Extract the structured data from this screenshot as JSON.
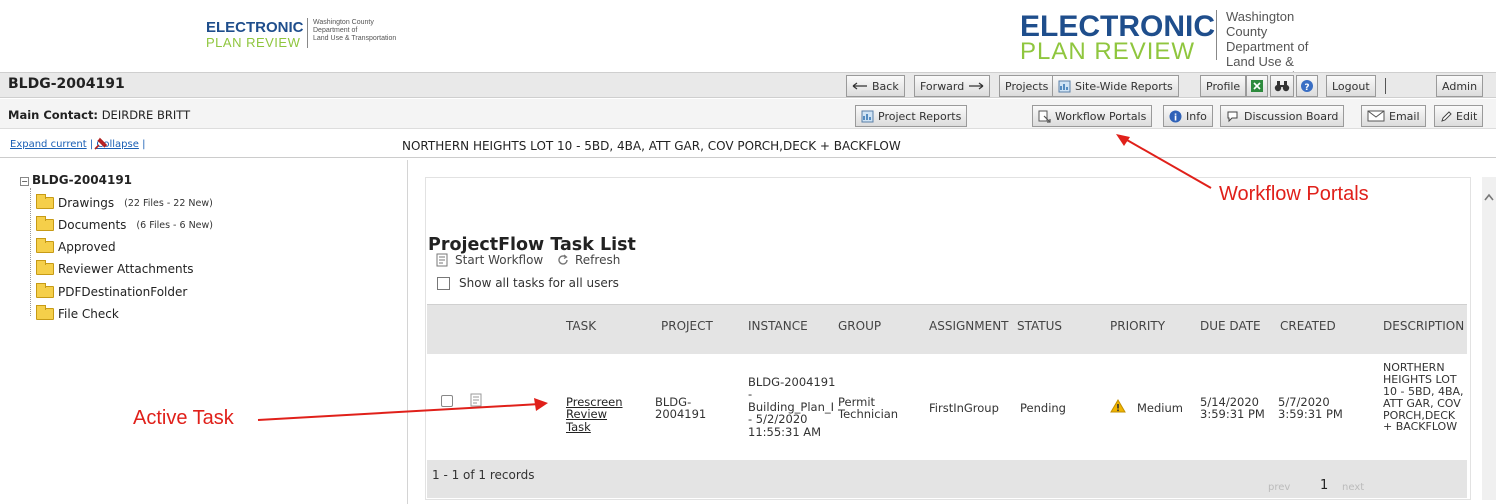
{
  "left_logo": {
    "title": "ELECTRONIC",
    "subtitle": "PLAN REVIEW",
    "dept_lines": [
      "Washington County",
      "Department of",
      "Land Use & Transportation"
    ]
  },
  "right_logo": {
    "title": "ELECTRONIC",
    "subtitle": "PLAN REVIEW",
    "dept_lines": [
      "Washington County",
      "Department of",
      "Land Use & Transportation"
    ]
  },
  "project_id": "BLDG-2004191",
  "nav_buttons": {
    "back": "Back",
    "forward": "Forward",
    "projects": "Projects",
    "site_wide_reports": "Site-Wide Reports",
    "profile": "Profile",
    "logout": "Logout",
    "admin": "Admin"
  },
  "contact": {
    "label": "Main Contact:",
    "name": "DEIRDRE BRITT"
  },
  "action_buttons": {
    "project_reports": "Project Reports",
    "workflow_portals": "Workflow Portals",
    "info": "Info",
    "discussion_board": "Discussion Board",
    "email": "Email",
    "edit": "Edit"
  },
  "tree_controls": {
    "expand": "Expand current",
    "collapse": "Collapse"
  },
  "project_description": "NORTHERN HEIGHTS LOT 10 - 5BD, 4BA, ATT GAR, COV PORCH,DECK + BACKFLOW",
  "tree": {
    "root": "BLDG-2004191",
    "items": [
      {
        "label": "Drawings",
        "meta": "(22 Files - 22 New)"
      },
      {
        "label": "Documents",
        "meta": "(6 Files - 6 New)"
      },
      {
        "label": "Approved",
        "meta": ""
      },
      {
        "label": "Reviewer Attachments",
        "meta": ""
      },
      {
        "label": "PDFDestinationFolder",
        "meta": ""
      },
      {
        "label": "File Check",
        "meta": ""
      }
    ]
  },
  "tasklist": {
    "title": "ProjectFlow Task List",
    "start_workflow": "Start Workflow",
    "refresh": "Refresh",
    "show_all": "Show all tasks for all users",
    "columns": [
      "TASK",
      "PROJECT",
      "INSTANCE",
      "GROUP",
      "ASSIGNMENT",
      "STATUS",
      "PRIORITY",
      "DUE DATE",
      "CREATED",
      "DESCRIPTION"
    ],
    "row": {
      "task": "Prescreen Review Task",
      "project": "BLDG-2004191",
      "instance": "BLDG-2004191 - Building_Plan_I - 5/2/2020 11:55:31 AM",
      "group": "Permit Technician",
      "assignment": "FirstInGroup",
      "status": "Pending",
      "priority": "Medium",
      "due_date": "5/14/2020 3:59:31 PM",
      "created": "5/7/2020 3:59:31 PM",
      "description": "NORTHERN HEIGHTS LOT 10 - 5BD, 4BA, ATT GAR, COV PORCH,DECK + BACKFLOW"
    },
    "records": "1 - 1 of 1 records",
    "pager": {
      "prev": "prev",
      "page": "1",
      "next": "next"
    }
  },
  "annotations": {
    "workflow_portals": "Workflow Portals",
    "active_task": "Active Task"
  },
  "colors": {
    "annotation_red": "#e0201a",
    "logo_blue": "#1f4e8c",
    "logo_green": "#8fc63e"
  }
}
